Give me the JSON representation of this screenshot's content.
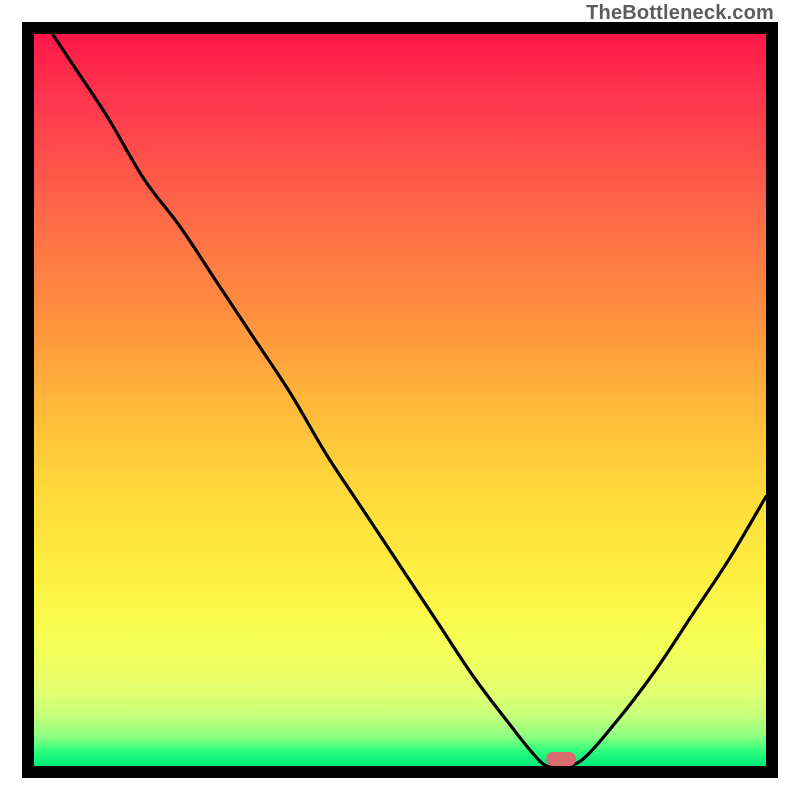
{
  "watermark": "TheBottleneck.com",
  "colors": {
    "frame": "#000000",
    "curve": "#000000",
    "min_marker": "#d86b6e",
    "gradient_top": "#ff1848",
    "gradient_bottom": "#00e97a"
  },
  "chart_data": {
    "type": "line",
    "title": "",
    "xlabel": "",
    "ylabel": "",
    "xlim": [
      0,
      100
    ],
    "ylim": [
      0,
      100
    ],
    "x": [
      0,
      5,
      10,
      15,
      20,
      25,
      30,
      35,
      40,
      45,
      50,
      55,
      60,
      65,
      68,
      70,
      72,
      75,
      80,
      85,
      90,
      95,
      100
    ],
    "values": [
      110,
      102,
      94,
      85,
      78,
      70,
      62,
      54,
      45,
      37,
      29,
      21,
      13,
      6,
      2,
      0,
      0,
      1,
      7,
      14,
      22,
      30,
      39
    ],
    "minimum_marker_x_range": [
      70,
      74
    ],
    "note": "A curve C(x) sampled on 0..100 (x) with a bottleneck error value (percent of 'badness', 0 = perfect match) on the y axis. Plot is drawn such that the curve's MINIMUM sits on the baseline (bottom of the inner gradient). Background color encodes badness: top = red (bad), bottom = green (good). The small rounded red marker near the bottom highlights the optimal x region."
  }
}
